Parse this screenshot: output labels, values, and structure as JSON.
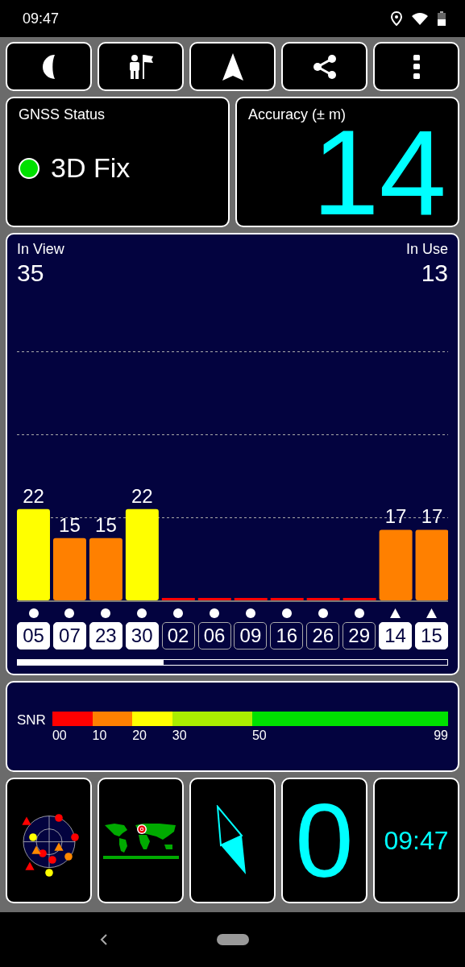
{
  "status_bar": {
    "time": "09:47"
  },
  "gnss_status": {
    "title": "GNSS Status",
    "value": "3D Fix",
    "fix_ok": true
  },
  "accuracy": {
    "title": "Accuracy (± m)",
    "value": "14"
  },
  "satellites": {
    "in_view_label": "In View",
    "in_view": "35",
    "in_use_label": "In Use",
    "in_use": "13",
    "chart_data": {
      "type": "bar",
      "categories": [
        "05",
        "07",
        "23",
        "30",
        "02",
        "06",
        "09",
        "16",
        "26",
        "29",
        "14",
        "15"
      ],
      "values": [
        22,
        15,
        15,
        22,
        0,
        0,
        0,
        0,
        0,
        0,
        17,
        17
      ],
      "value_labels": [
        "22",
        "15",
        "15",
        "22",
        null,
        null,
        null,
        null,
        null,
        null,
        "17",
        "17"
      ]
    },
    "markers": [
      {
        "kind": "circle",
        "in_use": true
      },
      {
        "kind": "circle",
        "in_use": true
      },
      {
        "kind": "circle",
        "in_use": true
      },
      {
        "kind": "circle",
        "in_use": true
      },
      {
        "kind": "circle",
        "in_use": false
      },
      {
        "kind": "circle",
        "in_use": false
      },
      {
        "kind": "circle",
        "in_use": false
      },
      {
        "kind": "circle",
        "in_use": false
      },
      {
        "kind": "circle",
        "in_use": false
      },
      {
        "kind": "circle",
        "in_use": false
      },
      {
        "kind": "triangle",
        "in_use": true
      },
      {
        "kind": "triangle",
        "in_use": true
      }
    ]
  },
  "snr": {
    "label": "SNR",
    "segments": [
      {
        "color": "#ff0000"
      },
      {
        "color": "#ff8000"
      },
      {
        "color": "#ffff00"
      },
      {
        "color": "#aaee00"
      },
      {
        "color": "#00e000"
      }
    ],
    "ticks": [
      "00",
      "10",
      "20",
      "30",
      "50",
      "99"
    ]
  },
  "tiles": {
    "speed": "0",
    "clock": "09:47"
  }
}
